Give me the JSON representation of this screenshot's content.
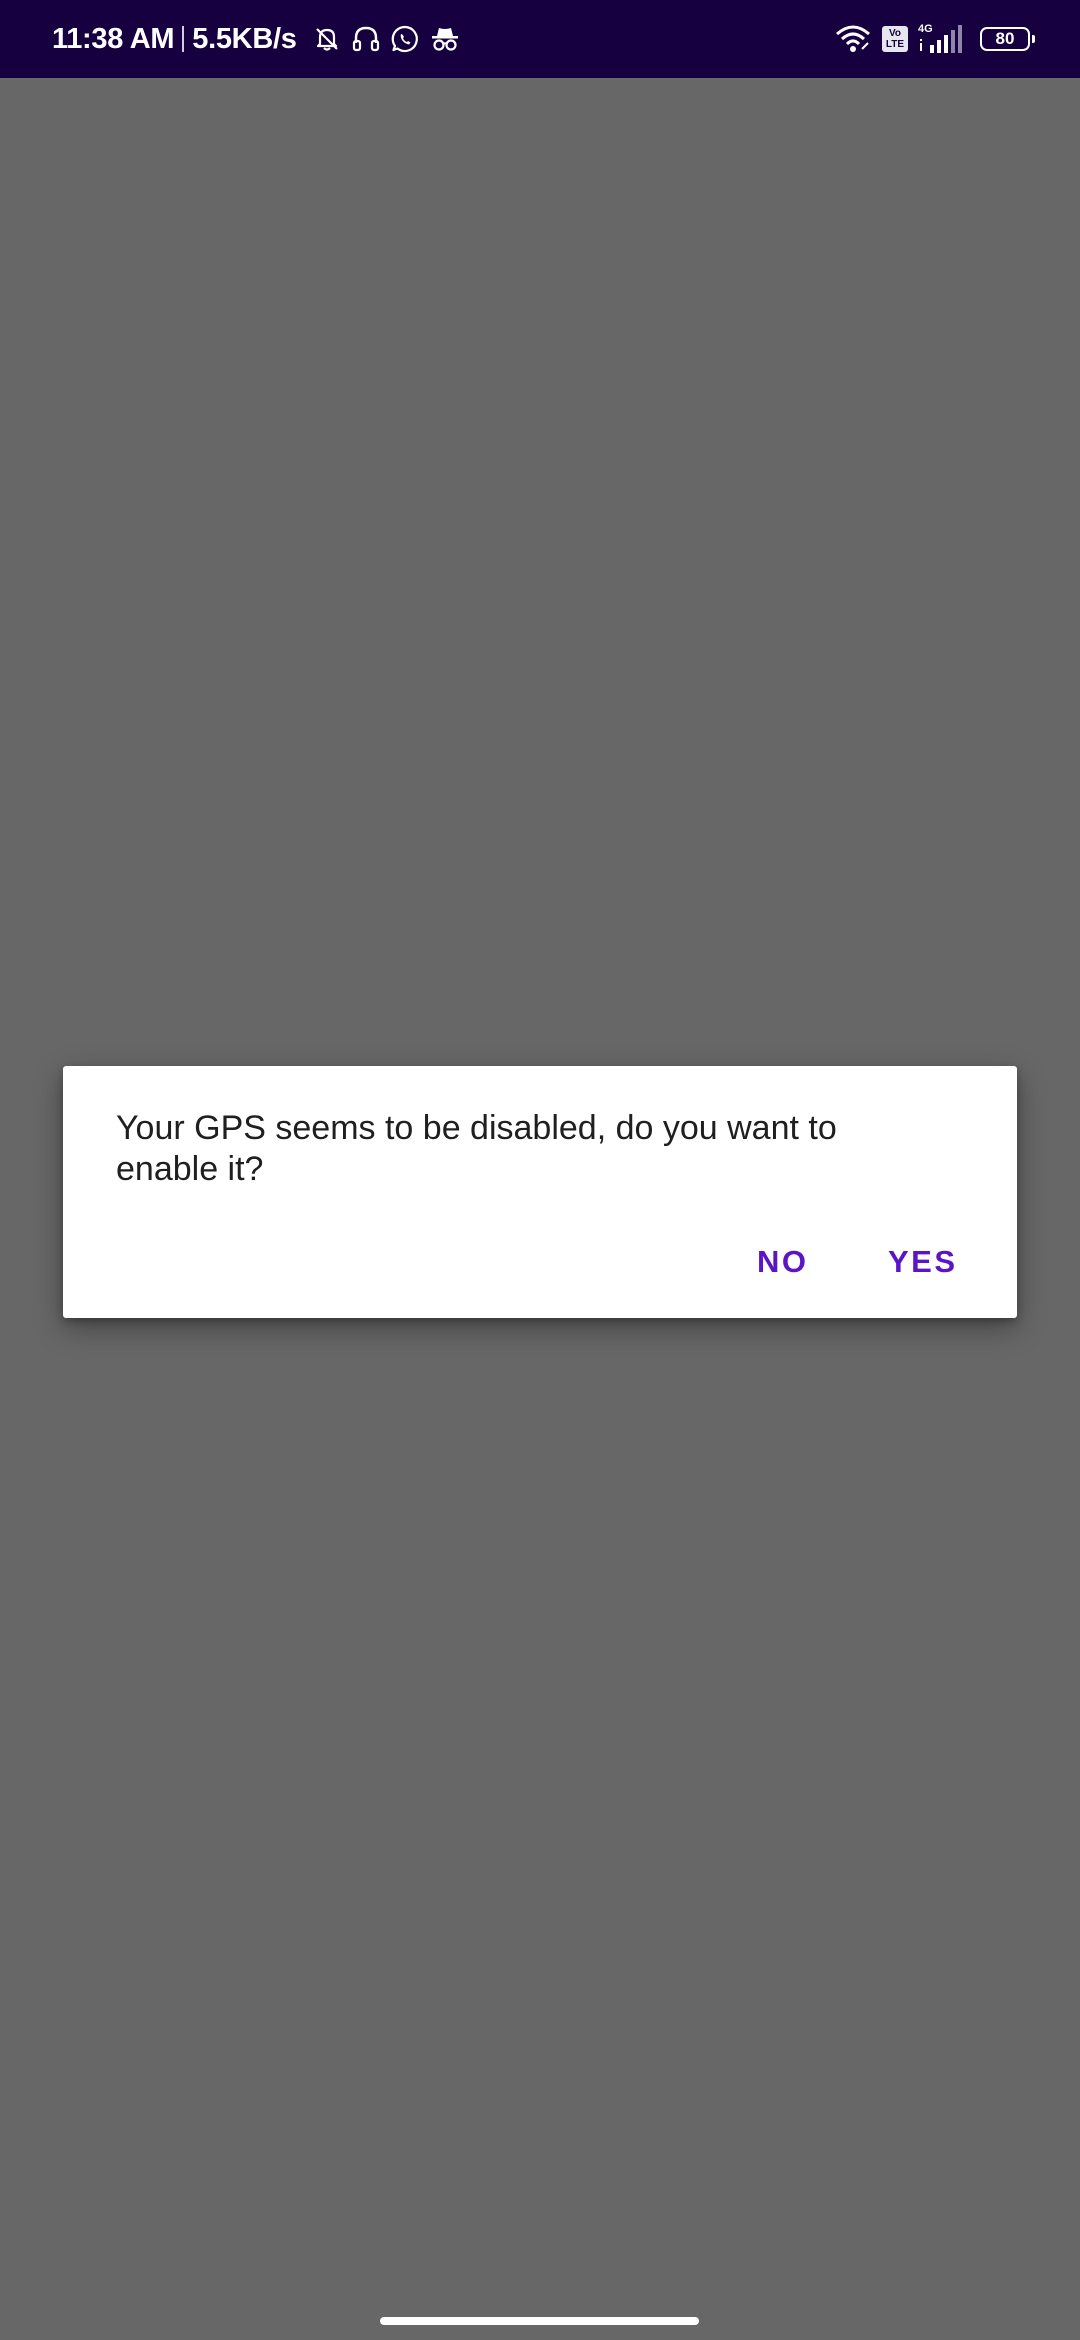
{
  "status_bar": {
    "time": "11:38 AM",
    "net_speed": "5.5KB/s",
    "left_icons": [
      "notifications-muted-icon",
      "headphones-icon",
      "whatsapp-icon",
      "incognito-icon"
    ],
    "right_icons": [
      "wifi-icon",
      "volte-icon",
      "signal-icon",
      "battery-icon"
    ],
    "volte_top": "Vo",
    "volte_bottom": "LTE",
    "network_type": "4G",
    "battery_level": "80",
    "background_color": "#16003f"
  },
  "dialog": {
    "message": "Your GPS seems to be disabled, do you want to enable it?",
    "negative_label": "NO",
    "positive_label": "YES",
    "accent_color": "#5b14c6"
  },
  "screen": {
    "scrim_color": "#676767"
  }
}
